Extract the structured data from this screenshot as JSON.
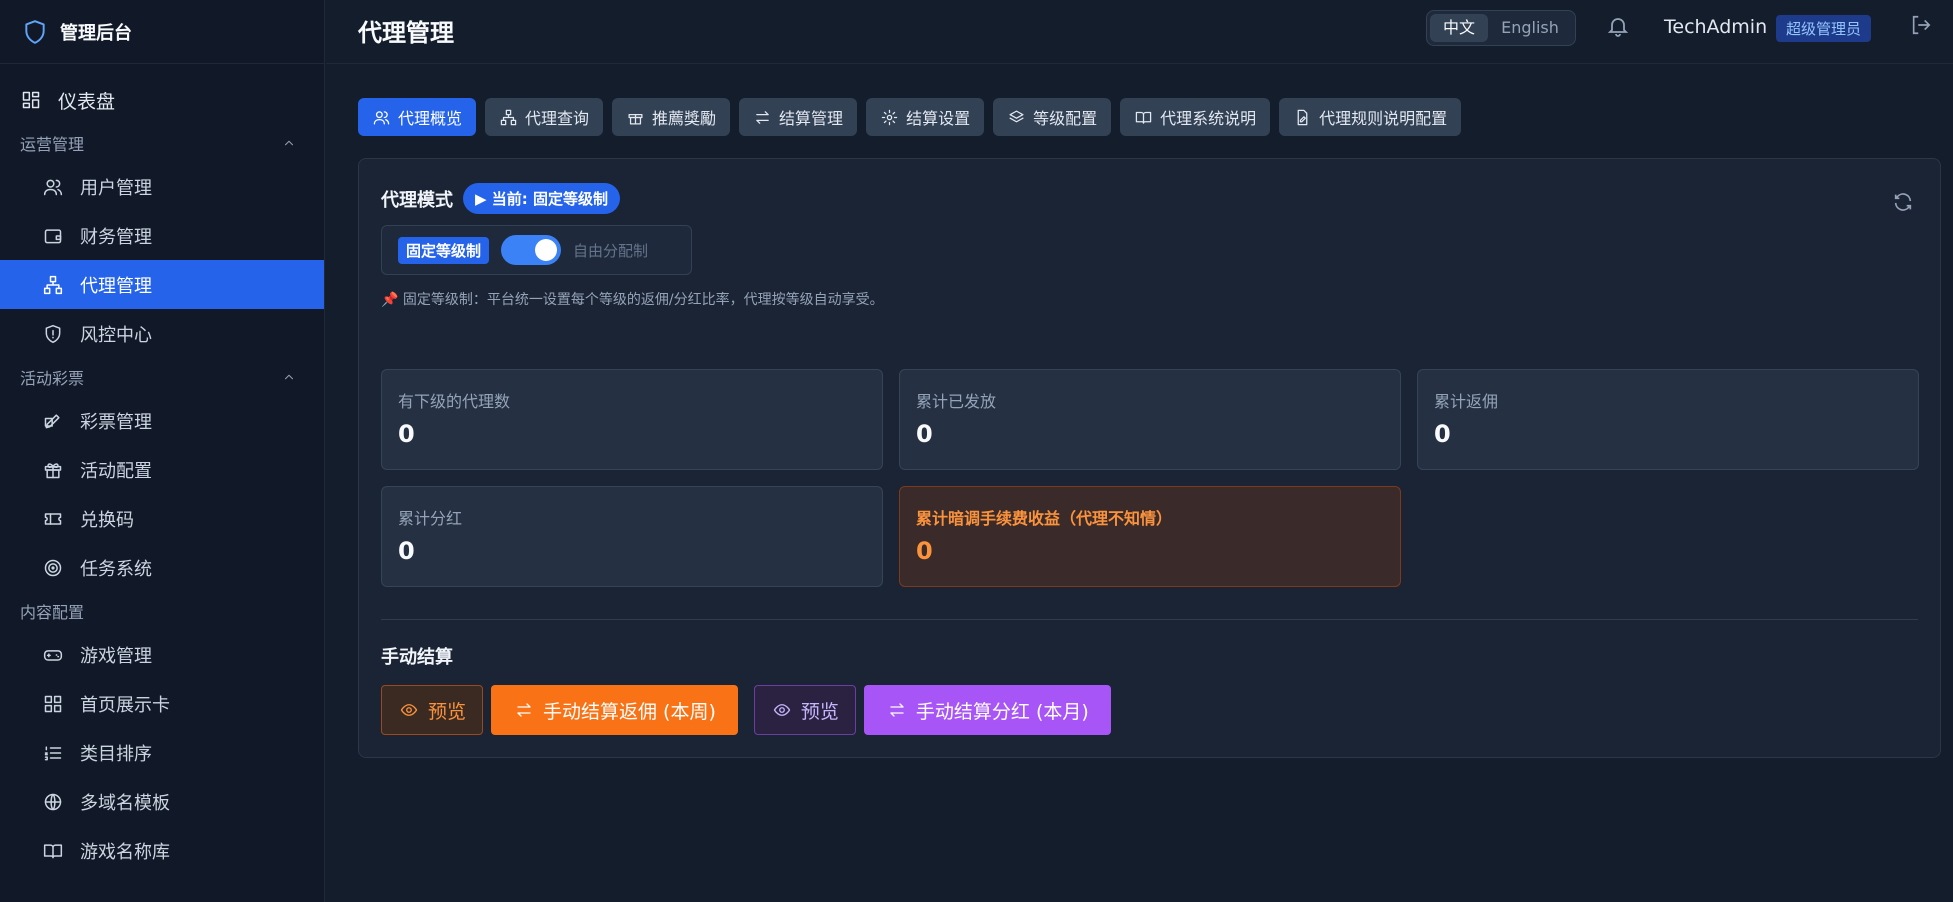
{
  "brand": {
    "title": "管理后台",
    "logo_icon": "shield-icon"
  },
  "sidebar": {
    "dashboard": {
      "label": "仪表盘",
      "icon": "dashboard-grid-icon"
    },
    "sections": [
      {
        "title": "运营管理",
        "items": [
          {
            "label": "用户管理",
            "icon": "users-icon"
          },
          {
            "label": "财务管理",
            "icon": "wallet-icon"
          },
          {
            "label": "代理管理",
            "icon": "network-icon",
            "active": true
          },
          {
            "label": "风控中心",
            "icon": "shield-icon"
          }
        ]
      },
      {
        "title": "活动彩票",
        "items": [
          {
            "label": "彩票管理",
            "icon": "ticket-icon"
          },
          {
            "label": "活动配置",
            "icon": "gift-icon"
          },
          {
            "label": "兑换码",
            "icon": "code-ticket-icon"
          },
          {
            "label": "任务系统",
            "icon": "target-icon"
          }
        ]
      },
      {
        "title": "内容配置",
        "items": [
          {
            "label": "游戏管理",
            "icon": "gamepad-icon"
          },
          {
            "label": "首页展示卡",
            "icon": "grid-icon"
          },
          {
            "label": "类目排序",
            "icon": "list-ordered-icon"
          },
          {
            "label": "多域名模板",
            "icon": "globe-icon"
          },
          {
            "label": "游戏名称库",
            "icon": "book-icon"
          }
        ]
      }
    ]
  },
  "header": {
    "title": "代理管理",
    "lang_zh": "中文",
    "lang_en": "English",
    "username": "TechAdmin",
    "role": "超级管理员"
  },
  "tabs": [
    {
      "label": "代理概览",
      "icon": "users-icon",
      "active": true
    },
    {
      "label": "代理查询",
      "icon": "network-icon"
    },
    {
      "label": "推薦獎勵",
      "icon": "gift-icon"
    },
    {
      "label": "结算管理",
      "icon": "swap-icon"
    },
    {
      "label": "结算设置",
      "icon": "gear-icon"
    },
    {
      "label": "等级配置",
      "icon": "layers-icon"
    },
    {
      "label": "代理系统说明",
      "icon": "book-open-icon"
    },
    {
      "label": "代理规则说明配置",
      "icon": "file-edit-icon"
    }
  ],
  "mode": {
    "label": "代理模式",
    "current": "▶ 当前: 固定等级制",
    "option_fixed": "固定等级制",
    "option_free": "自由分配制",
    "note": "📌 固定等级制：平台统一设置每个等级的返佣/分红比率，代理按等级自动享受。"
  },
  "stats": [
    {
      "label": "有下级的代理数",
      "value": "0"
    },
    {
      "label": "累计已发放",
      "value": "0"
    },
    {
      "label": "累计返佣",
      "value": "0"
    },
    {
      "label": "累计分红",
      "value": "0"
    },
    {
      "label": "累计暗调手续费收益（代理不知情）",
      "value": "0"
    }
  ],
  "manual": {
    "title": "手动结算",
    "preview1": "预览",
    "settle_rebate": "手动结算返佣 (本周)",
    "preview2": "预览",
    "settle_dividend": "手动结算分红 (本月)"
  }
}
